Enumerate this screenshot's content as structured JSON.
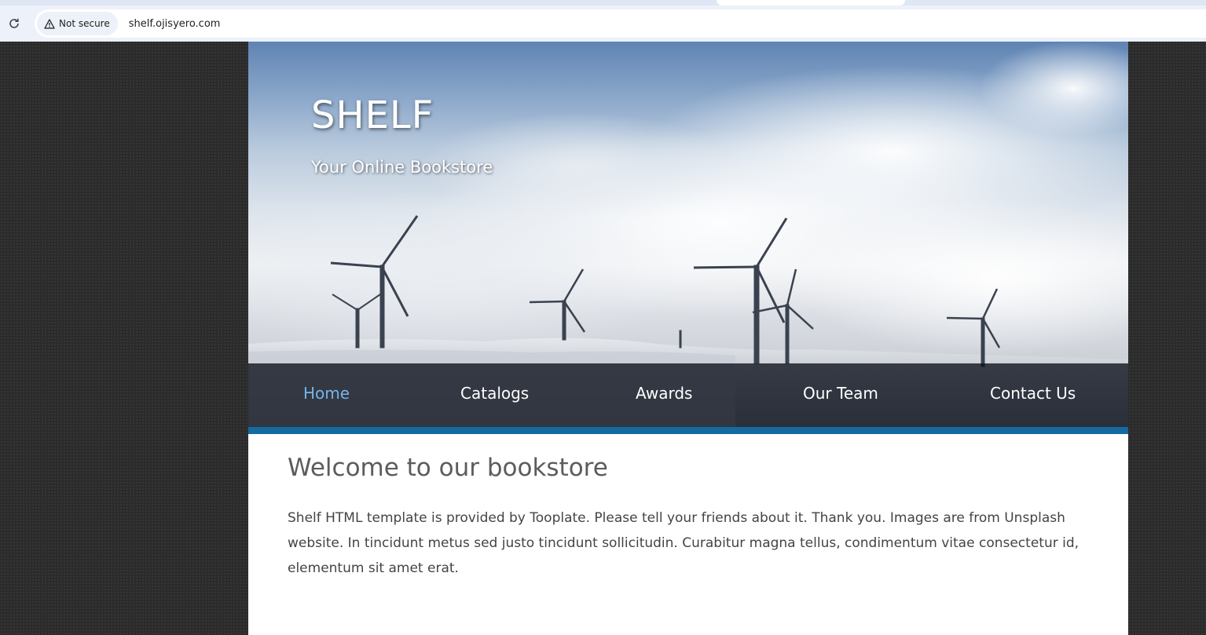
{
  "browser": {
    "security_label": "Not secure",
    "url": "shelf.ojisyero.com",
    "icons": {
      "reload": "reload-icon",
      "warning": "warning-triangle-icon"
    }
  },
  "site": {
    "title": "SHELF",
    "tagline": "Your Online Bookstore"
  },
  "nav": {
    "items": [
      {
        "label": "Home",
        "active": true
      },
      {
        "label": "Catalogs",
        "active": false
      },
      {
        "label": "Awards",
        "active": false
      },
      {
        "label": "Our Team",
        "active": false
      },
      {
        "label": "Contact Us",
        "active": false
      }
    ]
  },
  "main": {
    "heading": "Welcome to our bookstore",
    "paragraph": "Shelf HTML template is provided by Tooplate. Please tell your friends about it. Thank you. Images are from Unsplash website. In tincidunt metus sed justo tincidunt sollicitudin. Curabitur magna tellus, condimentum vitae consectetur id, elementum sit amet erat."
  },
  "colors": {
    "accent": "#146ba1",
    "nav_active": "#76b4e8",
    "page_background": "#2b2b2b"
  }
}
